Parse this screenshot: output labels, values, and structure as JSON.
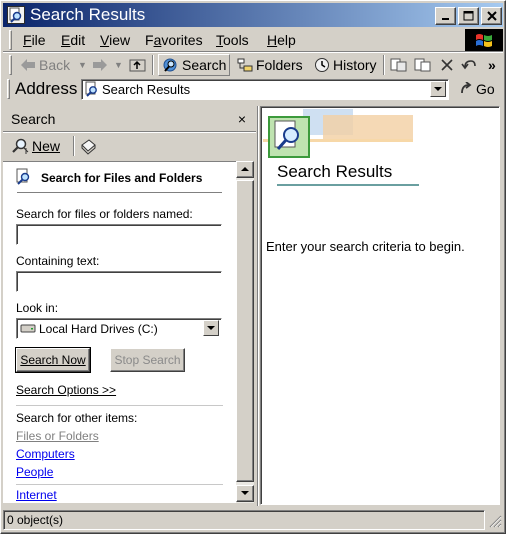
{
  "window": {
    "title": "Search Results"
  },
  "menu": [
    {
      "pre": "",
      "key": "F",
      "post": "ile"
    },
    {
      "pre": "",
      "key": "E",
      "post": "dit"
    },
    {
      "pre": "",
      "key": "V",
      "post": "iew"
    },
    {
      "pre": "F",
      "key": "a",
      "post": "vorites"
    },
    {
      "pre": "",
      "key": "T",
      "post": "ools"
    },
    {
      "pre": "",
      "key": "H",
      "post": "elp"
    }
  ],
  "toolbar": {
    "back": "Back",
    "search": "Search",
    "folders": "Folders",
    "history": "History",
    "overflow": "»"
  },
  "address": {
    "label": "Address",
    "value": "Search Results",
    "go": "Go"
  },
  "search_pane": {
    "header": "Search",
    "close": "×",
    "new_label": "New",
    "section_title": "Search for Files and Folders",
    "named_label": "Search for files or folders named:",
    "named_value": "",
    "containing_label": "Containing text:",
    "containing_value": "",
    "look_in_label": "Look in:",
    "look_in_value": "Local Hard Drives (C:)",
    "search_now": "Search Now",
    "stop_search": "Stop Search",
    "search_options": "Search Options >>",
    "other_items_label": "Search for other items:",
    "other_items": {
      "files_or_folders": "Files or Folders",
      "computers": "Computers",
      "people": "People",
      "internet": "Internet"
    }
  },
  "results_pane": {
    "title": "Search Results",
    "message": "Enter your search criteria to begin."
  },
  "status": {
    "text": "0 object(s)"
  },
  "colors": {
    "titlebar_start": "#0a246a",
    "titlebar_end": "#a6caf0",
    "link": "#0000ee",
    "visited_link": "#808080",
    "face": "#d4d0c8"
  }
}
